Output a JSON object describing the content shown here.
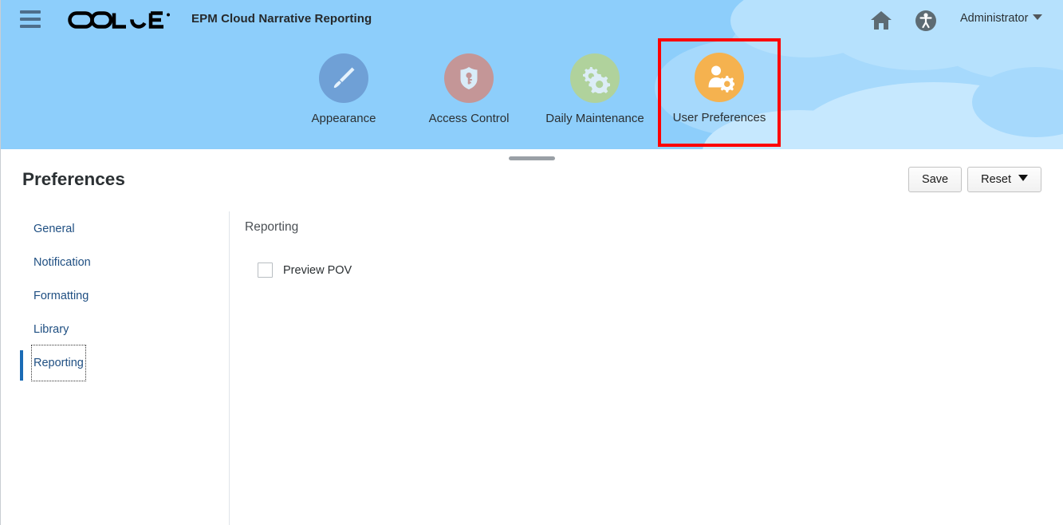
{
  "header": {
    "menu_icon": "hamburger-menu-icon",
    "brand": "ORACLE",
    "app_title": "EPM Cloud Narrative Reporting",
    "home_icon": "home-icon",
    "accessibility_icon": "accessibility-icon",
    "user_label": "Administrator"
  },
  "cards": [
    {
      "label": "Appearance",
      "icon": "paintbrush-icon",
      "color": "#6fa0d6",
      "highlighted": false
    },
    {
      "label": "Access Control",
      "icon": "shield-key-icon",
      "color": "#c49697",
      "highlighted": false
    },
    {
      "label": "Daily Maintenance",
      "icon": "gears-icon",
      "color": "#b0d29c",
      "highlighted": false
    },
    {
      "label": "User Preferences",
      "icon": "user-gear-icon",
      "color": "#f5b24f",
      "highlighted": true
    }
  ],
  "highlight_color": "#fe0000",
  "banner_color": "#8dceFB",
  "page": {
    "title": "Preferences",
    "save_label": "Save",
    "reset_label": "Reset"
  },
  "sidebar": {
    "items": [
      {
        "label": "General",
        "selected": false
      },
      {
        "label": "Notification",
        "selected": false
      },
      {
        "label": "Formatting",
        "selected": false
      },
      {
        "label": "Library",
        "selected": false
      },
      {
        "label": "Reporting",
        "selected": true
      }
    ]
  },
  "main": {
    "section_title": "Reporting",
    "options": [
      {
        "label": "Preview POV",
        "checked": false
      }
    ]
  }
}
